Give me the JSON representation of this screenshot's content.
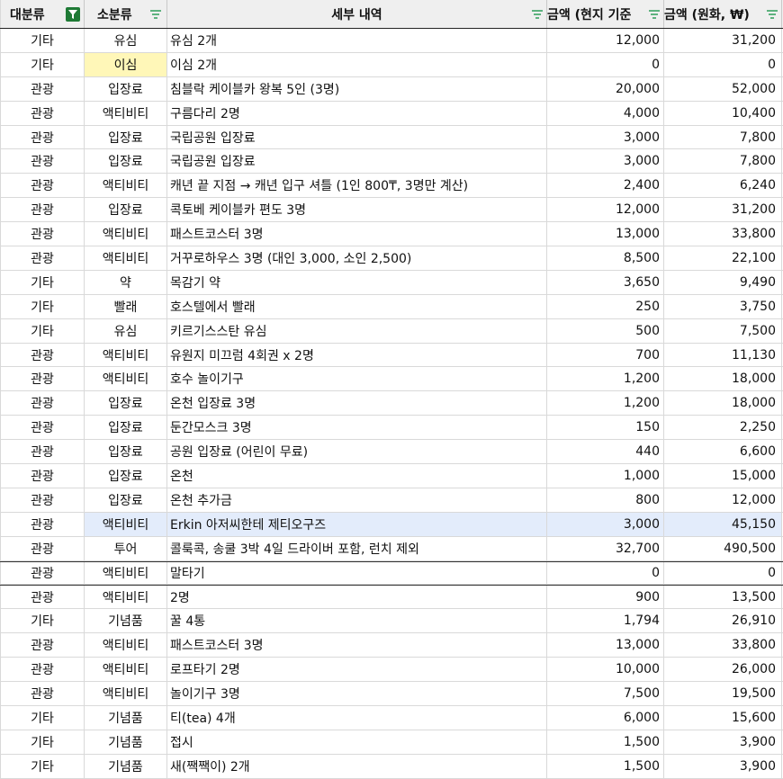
{
  "header": {
    "col_major": "대분류",
    "col_minor": "소분류",
    "col_detail": "세부 내역",
    "col_local": "금액 (현지 기준",
    "col_krw": "금액 (원화, ₩)"
  },
  "colors": {
    "filter_active": "#1e7a35",
    "filter_idle": "#2f9e5a",
    "highlight_yellow": "#fff7b8",
    "highlight_blue": "#e3ecfb"
  },
  "rows": [
    {
      "major": "기타",
      "minor": "유심",
      "detail": "유심 2개",
      "local": "12,000",
      "krw": "31,200"
    },
    {
      "major": "기타",
      "minor": "이심",
      "detail": "이심 2개",
      "local": "0",
      "krw": "0"
    },
    {
      "major": "관광",
      "minor": "입장료",
      "detail": "침블락 케이블카 왕복 5인 (3명)",
      "local": "20,000",
      "krw": "52,000"
    },
    {
      "major": "관광",
      "minor": "액티비티",
      "detail": "구름다리 2명",
      "local": "4,000",
      "krw": "10,400"
    },
    {
      "major": "관광",
      "minor": "입장료",
      "detail": "국립공원 입장료",
      "local": "3,000",
      "krw": "7,800"
    },
    {
      "major": "관광",
      "minor": "입장료",
      "detail": "국립공원 입장료",
      "local": "3,000",
      "krw": "7,800"
    },
    {
      "major": "관광",
      "minor": "액티비티",
      "detail": "캐년 끝 지점 → 캐년 입구 셔틀 (1인 800₸, 3명만 계산)",
      "local": "2,400",
      "krw": "6,240"
    },
    {
      "major": "관광",
      "minor": "입장료",
      "detail": "콕토베 케이블카 편도 3명",
      "local": "12,000",
      "krw": "31,200"
    },
    {
      "major": "관광",
      "minor": "액티비티",
      "detail": "패스트코스터 3명",
      "local": "13,000",
      "krw": "33,800"
    },
    {
      "major": "관광",
      "minor": "액티비티",
      "detail": "거꾸로하우스 3명 (대인 3,000, 소인 2,500)",
      "local": "8,500",
      "krw": "22,100"
    },
    {
      "major": "기타",
      "minor": "약",
      "detail": "목감기 약",
      "local": "3,650",
      "krw": "9,490"
    },
    {
      "major": "기타",
      "minor": "빨래",
      "detail": "호스텔에서 빨래",
      "local": "250",
      "krw": "3,750"
    },
    {
      "major": "기타",
      "minor": "유심",
      "detail": "키르기스스탄 유심",
      "local": "500",
      "krw": "7,500"
    },
    {
      "major": "관광",
      "minor": "액티비티",
      "detail": "유원지 미끄럼 4회권 x 2명",
      "local": "700",
      "krw": "11,130"
    },
    {
      "major": "관광",
      "minor": "액티비티",
      "detail": "호수 놀이기구",
      "local": "1,200",
      "krw": "18,000"
    },
    {
      "major": "관광",
      "minor": "입장료",
      "detail": "온천 입장료 3명",
      "local": "1,200",
      "krw": "18,000"
    },
    {
      "major": "관광",
      "minor": "입장료",
      "detail": "둔간모스크 3명",
      "local": "150",
      "krw": "2,250"
    },
    {
      "major": "관광",
      "minor": "입장료",
      "detail": "공원 입장료 (어린이 무료)",
      "local": "440",
      "krw": "6,600"
    },
    {
      "major": "관광",
      "minor": "입장료",
      "detail": "온천",
      "local": "1,000",
      "krw": "15,000"
    },
    {
      "major": "관광",
      "minor": "입장료",
      "detail": "온천 추가금",
      "local": "800",
      "krw": "12,000"
    },
    {
      "major": "관광",
      "minor": "액티비티",
      "detail": "Erkin 아저씨한테 제티오구즈",
      "local": "3,000",
      "krw": "45,150"
    },
    {
      "major": "관광",
      "minor": "투어",
      "detail": "콜룩콕, 송쿨 3박 4일 드라이버 포함, 런치 제외",
      "local": "32,700",
      "krw": "490,500"
    },
    {
      "major": "관광",
      "minor": "액티비티",
      "detail": "말타기",
      "local": "0",
      "krw": "0"
    },
    {
      "major": "관광",
      "minor": "액티비티",
      "detail": "2명",
      "local": "900",
      "krw": "13,500"
    },
    {
      "major": "기타",
      "minor": "기념품",
      "detail": "꿀 4통",
      "local": "1,794",
      "krw": "26,910"
    },
    {
      "major": "관광",
      "minor": "액티비티",
      "detail": "패스트코스터 3명",
      "local": "13,000",
      "krw": "33,800"
    },
    {
      "major": "관광",
      "minor": "액티비티",
      "detail": "로프타기 2명",
      "local": "10,000",
      "krw": "26,000"
    },
    {
      "major": "관광",
      "minor": "액티비티",
      "detail": "놀이기구 3명",
      "local": "7,500",
      "krw": "19,500"
    },
    {
      "major": "기타",
      "minor": "기념품",
      "detail": "티(tea) 4개",
      "local": "6,000",
      "krw": "15,600"
    },
    {
      "major": "기타",
      "minor": "기념품",
      "detail": "접시",
      "local": "1,500",
      "krw": "3,900"
    },
    {
      "major": "기타",
      "minor": "기념품",
      "detail": "새(짹짹이) 2개",
      "local": "1,500",
      "krw": "3,900"
    }
  ]
}
